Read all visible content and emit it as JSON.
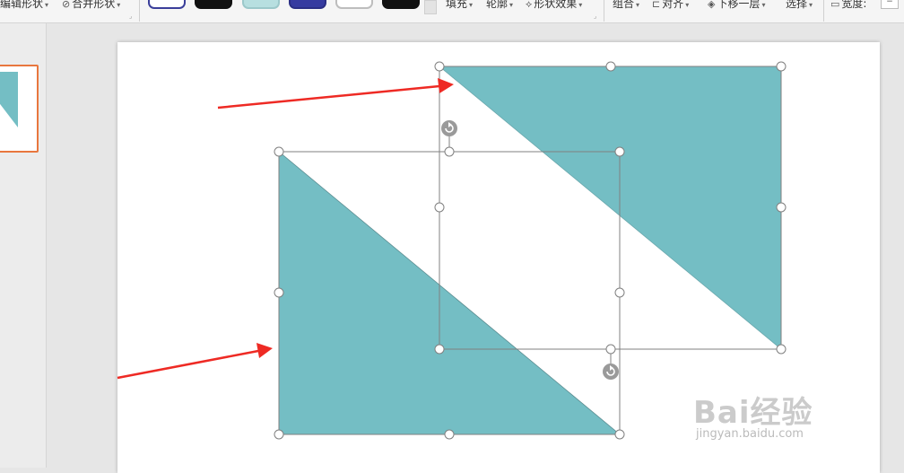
{
  "ribbon": {
    "edit_shape": {
      "label": "编辑形状",
      "icon": "edit-shape-icon"
    },
    "merge_shape": {
      "label": "合并形状",
      "icon": "merge-shape-icon"
    },
    "style_swatches": [
      {
        "name": "outline-navy",
        "fill": "#ffffff",
        "border": "#3b3f9a"
      },
      {
        "name": "solid-black",
        "fill": "#111111",
        "border": "#111111"
      },
      {
        "name": "light-teal",
        "fill": "#b7dfe0",
        "border": "#9cc8ca"
      },
      {
        "name": "deep-blue",
        "fill": "#363ba0",
        "border": "#2b2f85"
      },
      {
        "name": "plain-white",
        "fill": "#ffffff",
        "border": "#bdbdbd"
      },
      {
        "name": "solid-black-2",
        "fill": "#111111",
        "border": "#111111"
      }
    ],
    "fill": {
      "label": "填充"
    },
    "outline": {
      "label": "轮廓"
    },
    "shape_effects": {
      "label": "形状效果",
      "icon": "shape-effects-icon"
    },
    "group": {
      "label": "组合"
    },
    "align": {
      "label": "对齐",
      "icon": "align-icon"
    },
    "send_backward": {
      "label": "下移一层",
      "icon": "send-backward-icon"
    },
    "select": {
      "label": "选择"
    },
    "width": {
      "label": "宽度:",
      "icon": "width-icon",
      "value": "−"
    }
  },
  "colors": {
    "teal": "#74bec4",
    "arrow": "#ee2a24",
    "selection_border": "#808080",
    "handle_fill": "#ffffff",
    "rotate_handle": "#9a9a9a",
    "thumb_border": "#e8773e"
  },
  "watermark": {
    "brand": "Bai经验",
    "url": "jingyan.baidu.com"
  }
}
